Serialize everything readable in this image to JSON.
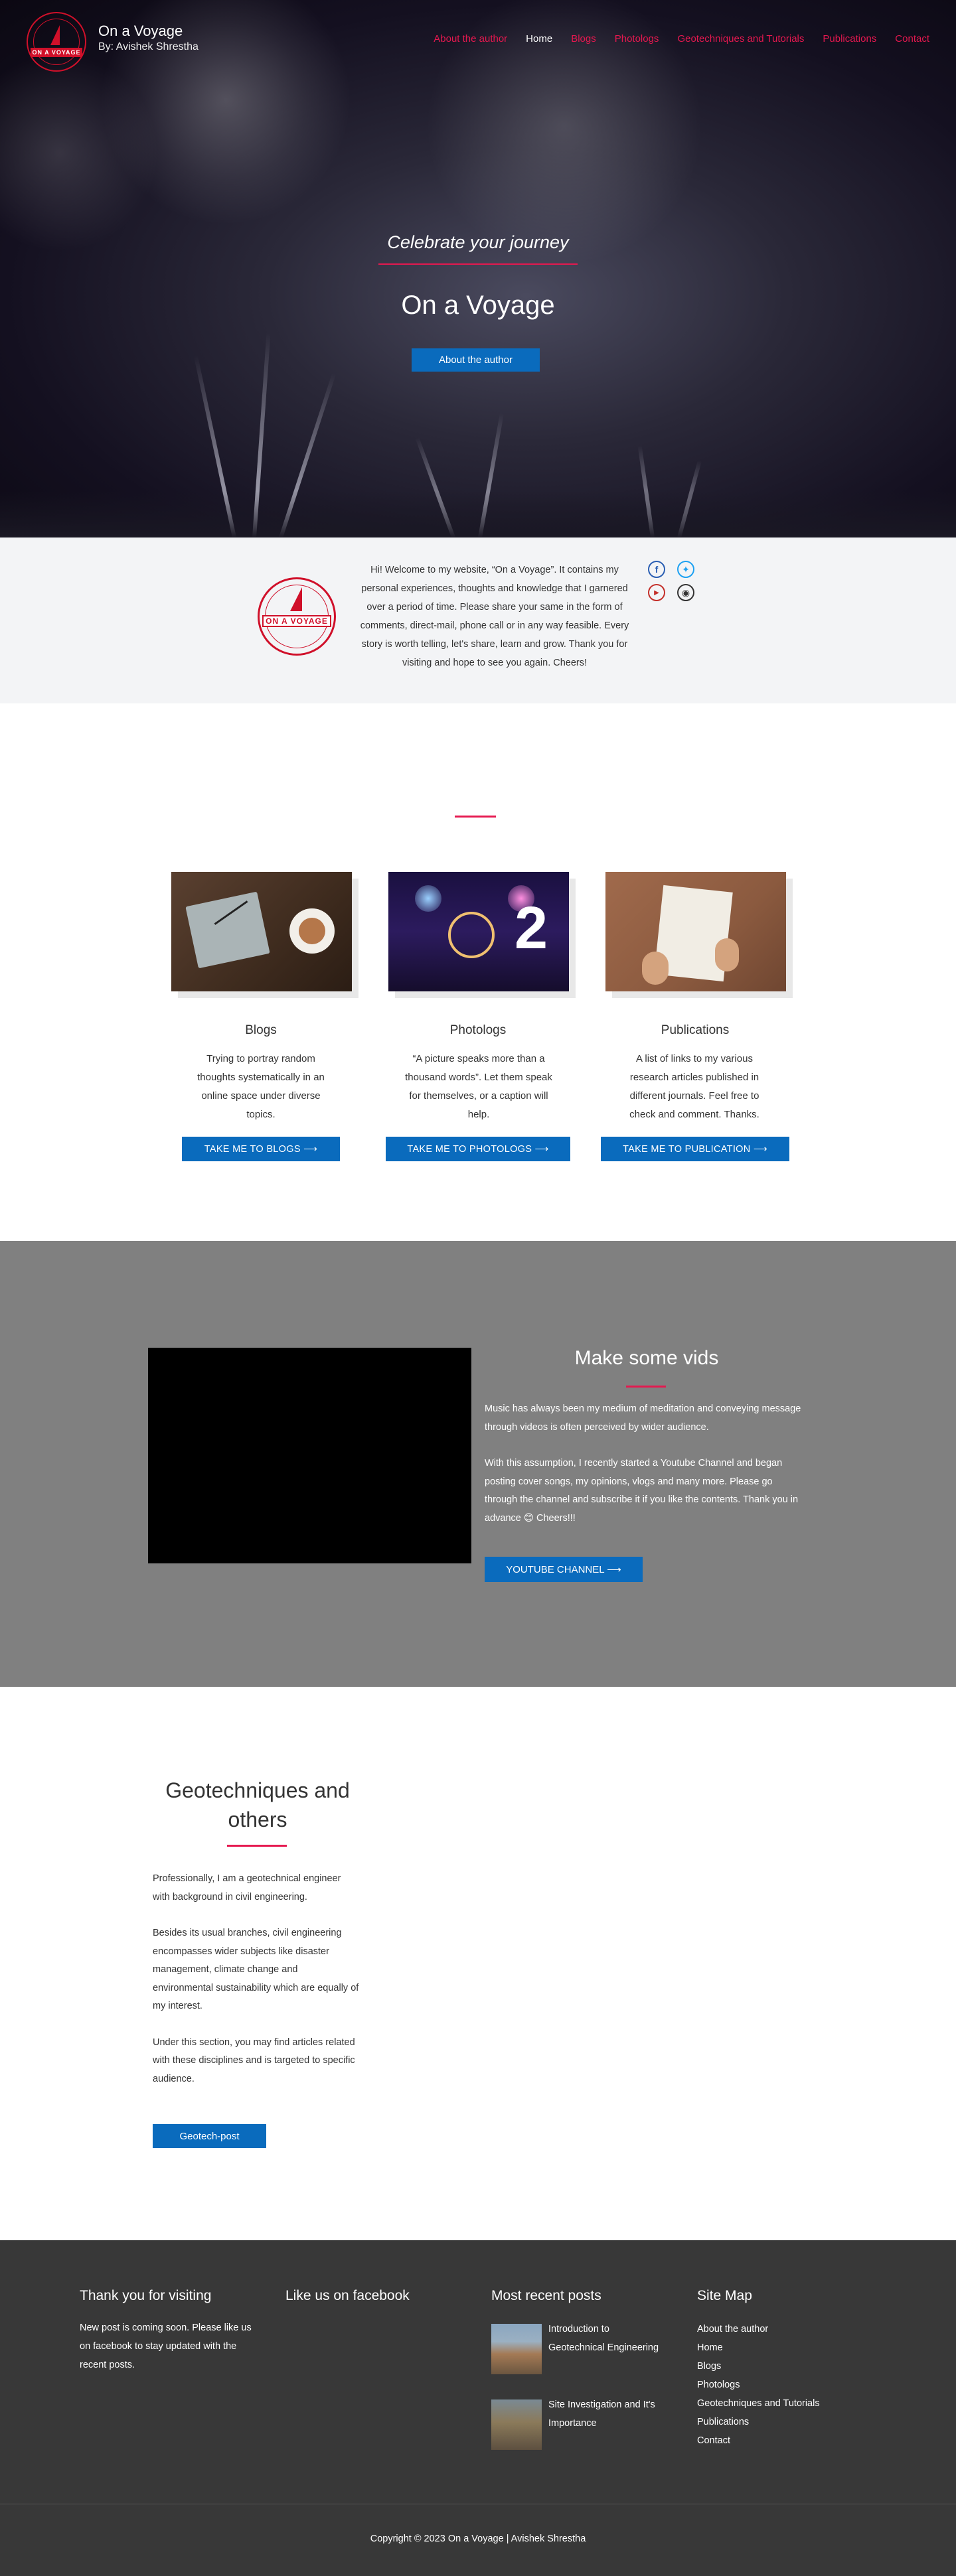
{
  "header": {
    "logo_text": "ON A VOYAGE",
    "site_title": "On a Voyage",
    "site_subtitle": "By: Avishek Shrestha",
    "nav": [
      {
        "label": "About the author",
        "active": false
      },
      {
        "label": "Home",
        "active": true
      },
      {
        "label": "Blogs",
        "active": false
      },
      {
        "label": "Photologs",
        "active": false
      },
      {
        "label": "Geotechniques and Tutorials",
        "active": false
      },
      {
        "label": "Publications",
        "active": false
      },
      {
        "label": "Contact",
        "active": false
      }
    ]
  },
  "hero": {
    "tagline": "Celebrate your journey",
    "title": "On a Voyage",
    "button": "About the author"
  },
  "welcome": {
    "logo_text": "ON A VOYAGE",
    "text": "Hi! Welcome to my website, “On a Voyage”. It contains my personal experiences, thoughts and knowledge that I garnered over a period of time. Please share your same in the form of comments, direct-mail, phone call or in any way feasible. Every story is worth telling, let's share, learn and grow. Thank you for visiting and hope to see you again. Cheers!",
    "social_icons": [
      "facebook-icon",
      "twitter-icon",
      "youtube-icon",
      "instagram-icon"
    ]
  },
  "services": [
    {
      "title": "Blogs",
      "text": "Trying to portray random thoughts systematically in an online space under diverse topics.",
      "button": "TAKE ME TO BLOGS ⟶"
    },
    {
      "title": "Photologs",
      "text": "“A picture speaks more than a thousand words”. Let them speak for themselves, or a caption will help.",
      "button": "TAKE ME TO PHOTOLOGS ⟶"
    },
    {
      "title": "Publications",
      "text": "A list of links to my various research articles published in different journals. Feel free to check and comment. Thanks.",
      "button": "TAKE ME TO PUBLICATION ⟶"
    }
  ],
  "video": {
    "title": "Make some vids",
    "para1": "Music has always been my medium of meditation and conveying message through videos is often perceived by wider audience.",
    "para2": "With this assumption, I recently started a Youtube Channel and began posting cover songs, my opinions, vlogs and many more. Please go through the channel and subscribe it if you like the contents. Thank you in advance 😊 Cheers!!!",
    "button": "YOUTUBE CHANNEL ⟶"
  },
  "geotech": {
    "title": "Geotechniques and others",
    "para1": "Professionally, I am a geotechnical engineer with background in civil engineering.",
    "para2": "Besides its usual branches, civil engineering encompasses wider subjects like disaster management, climate change and environmental sustainability which are equally of my interest.",
    "para3": "Under this section, you may find articles related with these disciplines and is targeted to specific audience.",
    "button": "Geotech-post"
  },
  "footer": {
    "col1_title": "Thank you for visiting",
    "col1_text": "New post is coming soon. Please like us on facebook to stay updated with the recent posts.",
    "col2_title": "Like us on facebook",
    "col3_title": "Most recent posts",
    "posts": [
      {
        "title": "Introduction to Geotechnical Engineering"
      },
      {
        "title": "Site Investigation and It's Importance"
      }
    ],
    "col4_title": "Site Map",
    "sitemap": [
      "About the author",
      "Home",
      "Blogs",
      "Photologs",
      "Geotechniques and Tutorials",
      "Publications",
      "Contact"
    ],
    "copyright": "Copyright © 2023 On a Voyage | Avishek Shrestha"
  },
  "colors": {
    "accent": "#e5184f",
    "button": "#0a6bbd",
    "footer_bg": "#383838",
    "video_bg": "#808080"
  }
}
